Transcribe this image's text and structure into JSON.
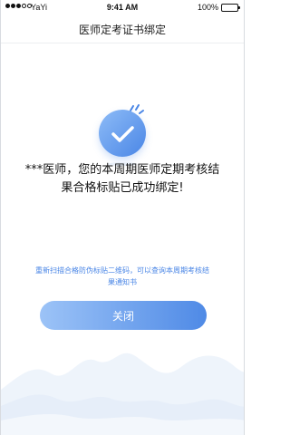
{
  "status_bar": {
    "carrier": "YaYi",
    "time": "9:41 AM",
    "battery": "100%",
    "signal_bars_filled": 3,
    "signal_bars_total": 5
  },
  "nav": {
    "title": "医师定考证书绑定"
  },
  "icons": {
    "success": "check-circle-icon",
    "sparkle": "sparkle-icon"
  },
  "message": {
    "line1": "***医师，您的本周期医师定期考核结",
    "line2": "果合格标贴已成功绑定!"
  },
  "hint": {
    "line1": "重新扫描合格防伪标贴二维码，可以查询本周期考核结",
    "line2": "果通知书"
  },
  "close_button": {
    "label": "关闭"
  },
  "colors": {
    "accent": "#4a86e6",
    "accent_light": "#9cc3f7",
    "wave": "#edf3fb"
  }
}
